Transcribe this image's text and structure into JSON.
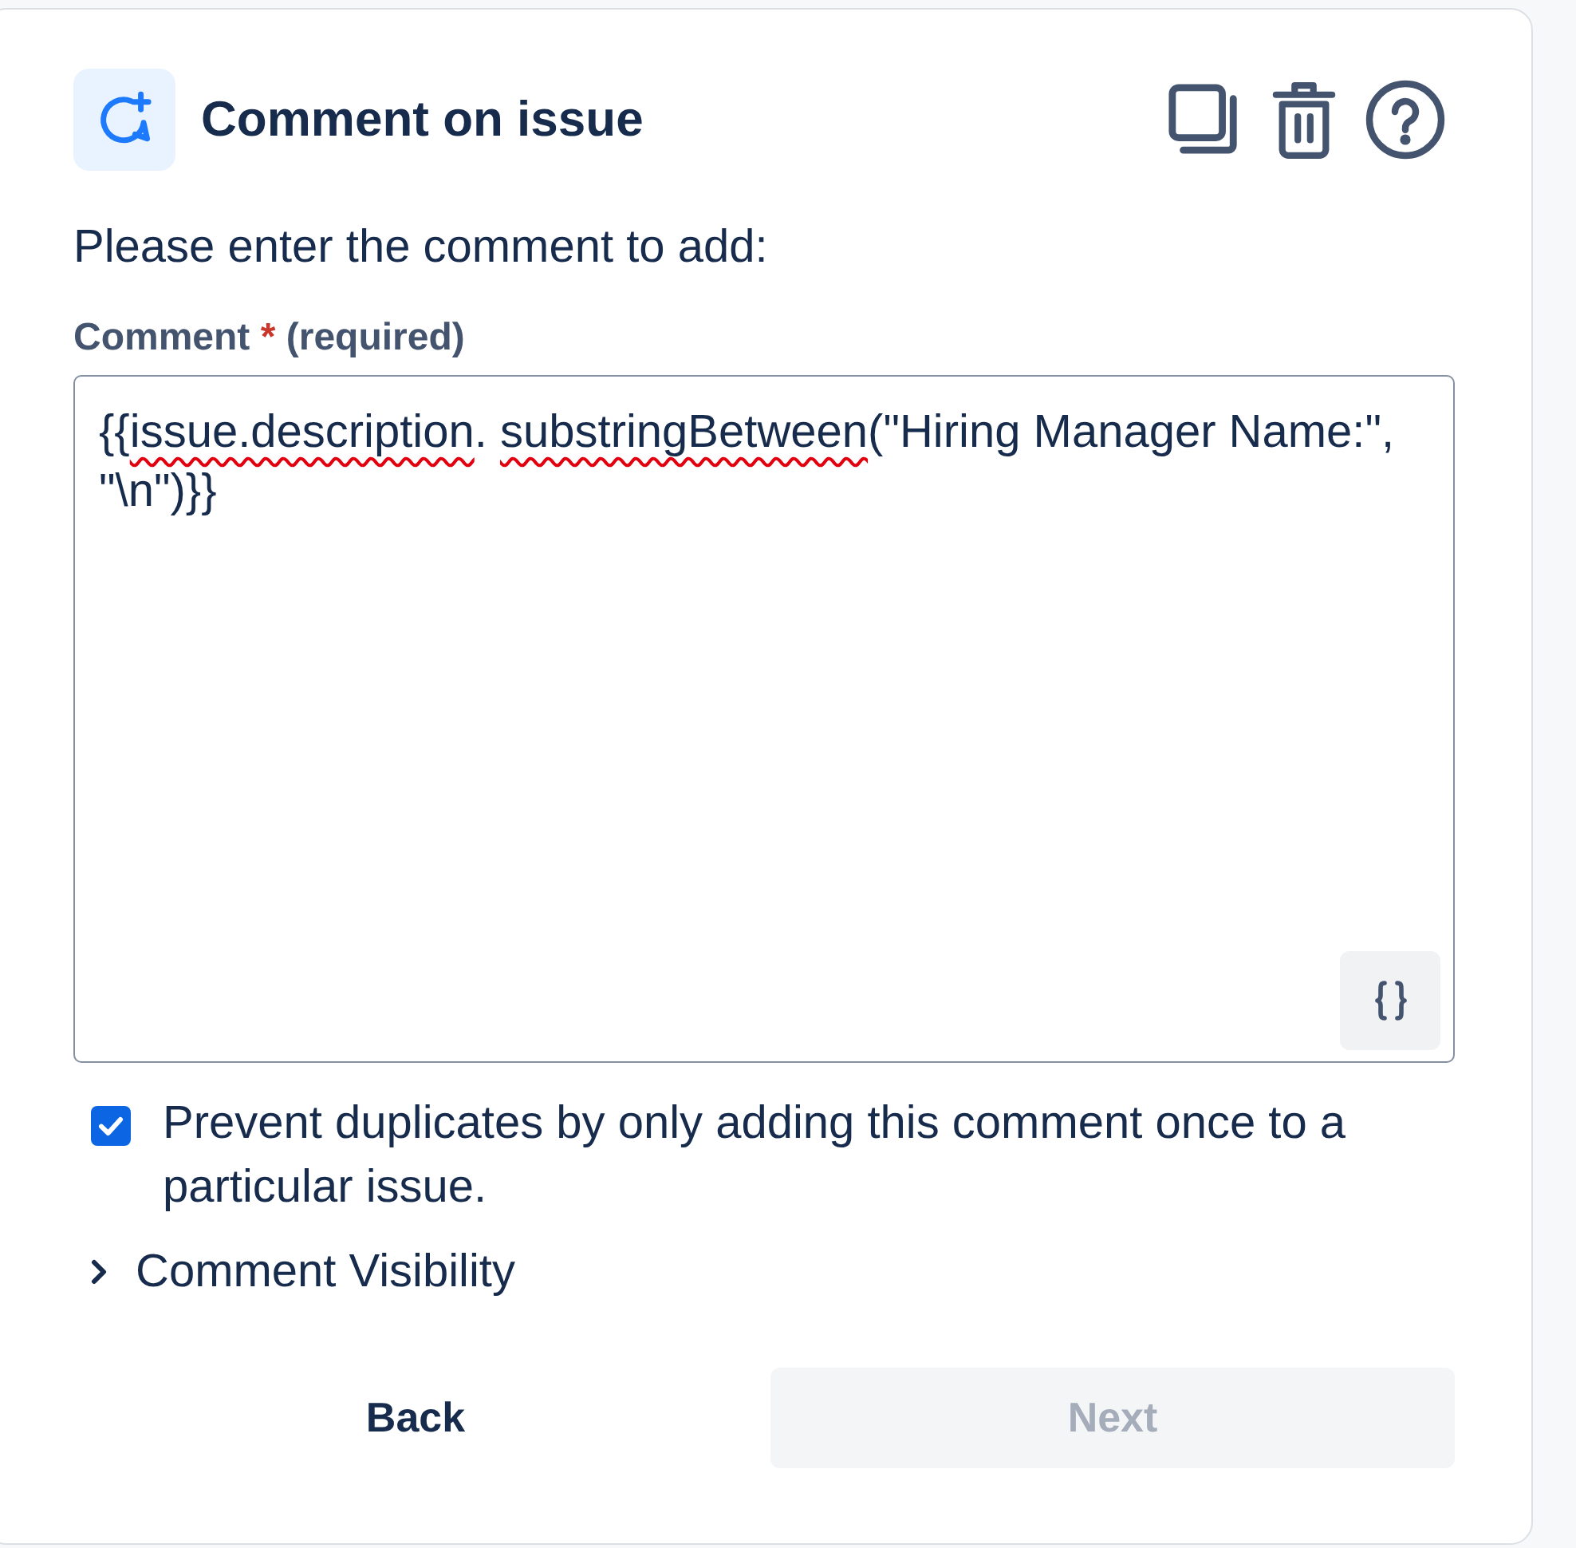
{
  "header": {
    "title": "Comment on issue"
  },
  "intro": "Please enter the comment to add:",
  "comment_field": {
    "label": "Comment",
    "required_mark": "*",
    "hint": "(required)",
    "value": [
      {
        "text": "{{",
        "misspelled": false
      },
      {
        "text": "issue.description",
        "misspelled": true
      },
      {
        "text": ". ",
        "misspelled": false
      },
      {
        "text": "substringBetween",
        "misspelled": true
      },
      {
        "text": "(\"Hiring Manager Name:\", \"\\n\")}}",
        "misspelled": false
      }
    ]
  },
  "prevent_duplicates": {
    "label": "Prevent duplicates by only adding this comment once to a particular issue.",
    "checked": true
  },
  "visibility": {
    "label": "Comment Visibility",
    "expanded": false
  },
  "buttons": [
    {
      "label": "Back",
      "kind": "subtle",
      "disabled": false
    },
    {
      "label": "Next",
      "kind": "primary",
      "disabled": true
    }
  ]
}
